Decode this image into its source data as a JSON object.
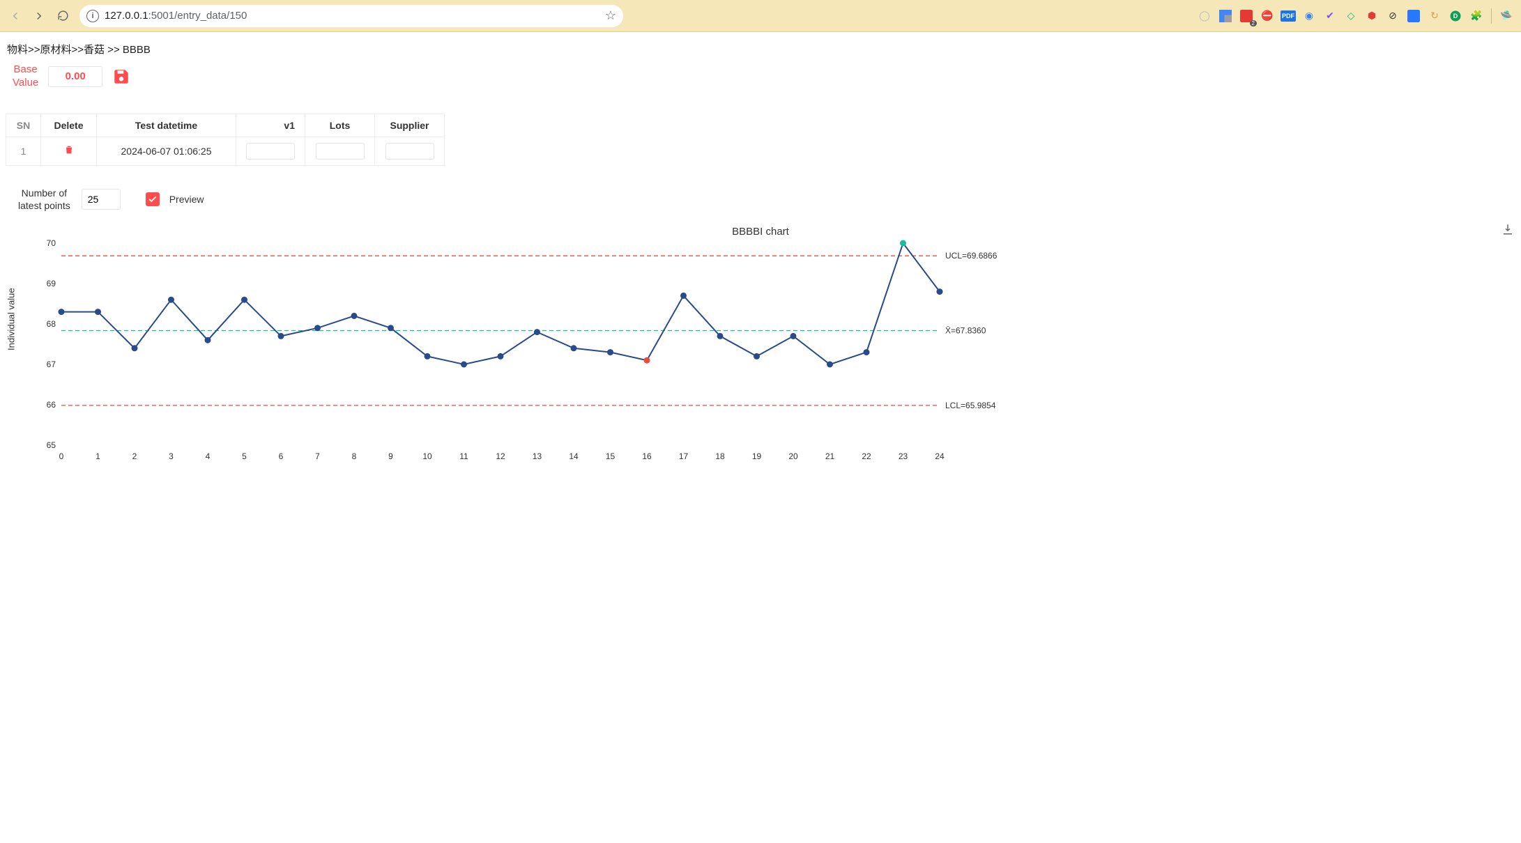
{
  "browser": {
    "url_host": "127.0.0.1",
    "url_port_path": ":5001/entry_data/150"
  },
  "breadcrumb": "物料>>原材料>>香菇 >> BBBB",
  "base": {
    "label_line1": "Base",
    "label_line2": "Value",
    "value": "0.00"
  },
  "table": {
    "headers": {
      "sn": "SN",
      "delete": "Delete",
      "datetime": "Test datetime",
      "v1": "v1",
      "lots": "Lots",
      "supplier": "Supplier"
    },
    "rows": [
      {
        "sn": "1",
        "datetime": "2024-06-07 01:06:25",
        "v1": "",
        "lots": "",
        "supplier": ""
      }
    ]
  },
  "controls": {
    "num_points_label_line1": "Number of",
    "num_points_label_line2": "latest points",
    "num_points_value": "25",
    "preview_checked": true,
    "preview_label": "Preview"
  },
  "chart": {
    "title": "BBBBI chart",
    "ylabel": "Individual value",
    "ucl_label": "UCL=69.6866",
    "mean_label": "X̄=67.8360",
    "lcl_label": "LCL=65.9854"
  },
  "chart_data": {
    "type": "line",
    "title": "BBBBI chart",
    "xlabel": "",
    "ylabel": "Individual value",
    "x": [
      0,
      1,
      2,
      3,
      4,
      5,
      6,
      7,
      8,
      9,
      10,
      11,
      12,
      13,
      14,
      15,
      16,
      17,
      18,
      19,
      20,
      21,
      22,
      23,
      24
    ],
    "values": [
      68.3,
      68.3,
      67.4,
      68.6,
      67.6,
      68.6,
      67.7,
      67.9,
      68.2,
      67.9,
      67.2,
      67.0,
      67.2,
      67.8,
      67.4,
      67.3,
      67.1,
      68.7,
      67.7,
      67.2,
      67.7,
      67.0,
      67.3,
      70.0,
      68.8
    ],
    "point_flags": {
      "16": "red",
      "23": "green"
    },
    "reference_lines": {
      "UCL": 69.6866,
      "mean": 67.836,
      "LCL": 65.9854
    },
    "ylim": [
      65,
      70
    ],
    "y_ticks": [
      65,
      66,
      67,
      68,
      69,
      70
    ],
    "x_ticks": [
      0,
      1,
      2,
      3,
      4,
      5,
      6,
      7,
      8,
      9,
      10,
      11,
      12,
      13,
      14,
      15,
      16,
      17,
      18,
      19,
      20,
      21,
      22,
      23,
      24
    ]
  }
}
